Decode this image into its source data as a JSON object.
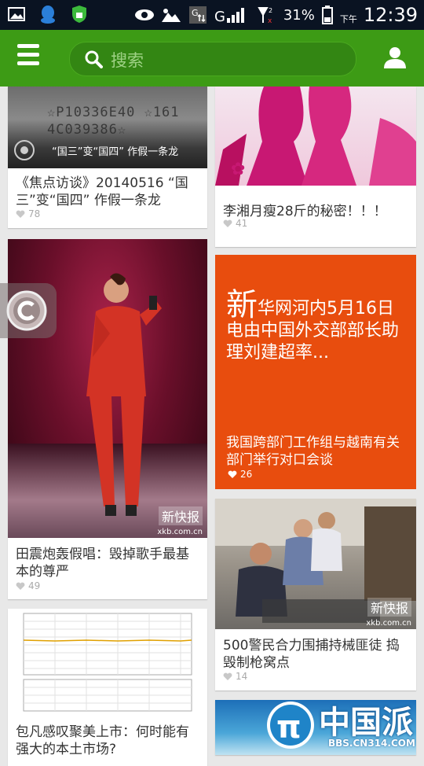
{
  "status_bar": {
    "battery": "31%",
    "time": "12:39",
    "am_pm": "下午",
    "network": "G",
    "icons": [
      "image-icon",
      "qq-icon",
      "shield-icon",
      "eye-icon",
      "signal-icon",
      "battery-icon"
    ]
  },
  "app_bar": {
    "search_placeholder": "搜索",
    "icons": [
      "menu-icon",
      "search-icon",
      "user-icon"
    ]
  },
  "feed": {
    "left": [
      {
        "title": "《焦点访谈》20140516 “国三”变“国四” 作假一条龙",
        "likes": "78",
        "image_caption": "“国三”变“国四” 作假一条龙",
        "plate_text": "☆P10336E40 ☆1614C039386☆"
      },
      {
        "title": "田震炮轰假唱：毁掉歌手最基本的尊严",
        "likes": "49",
        "image_tag": "新快报",
        "image_source": "xkb.com.cn"
      },
      {
        "title": "包凡感叹聚美上市：何时能有强大的本土市场?"
      }
    ],
    "right": [
      {
        "title": "李湘月瘦28斤的秘密！！！",
        "likes": "41"
      },
      {
        "news_headline_first": "新",
        "news_headline_rest": "华网河内5月16日电由中国外交部部长助理刘建超率...",
        "news_subtitle": "我国跨部门工作组与越南有关部门举行对口会谈",
        "likes": "26"
      },
      {
        "title": "500警民合力围捕持械匪徒 捣毁制枪窝点",
        "likes": "14",
        "image_tag": "新快报",
        "image_source": "xkb.com.cn"
      }
    ]
  },
  "watermark": {
    "brand": "中国派",
    "site": "BBS.CN314.COM"
  }
}
